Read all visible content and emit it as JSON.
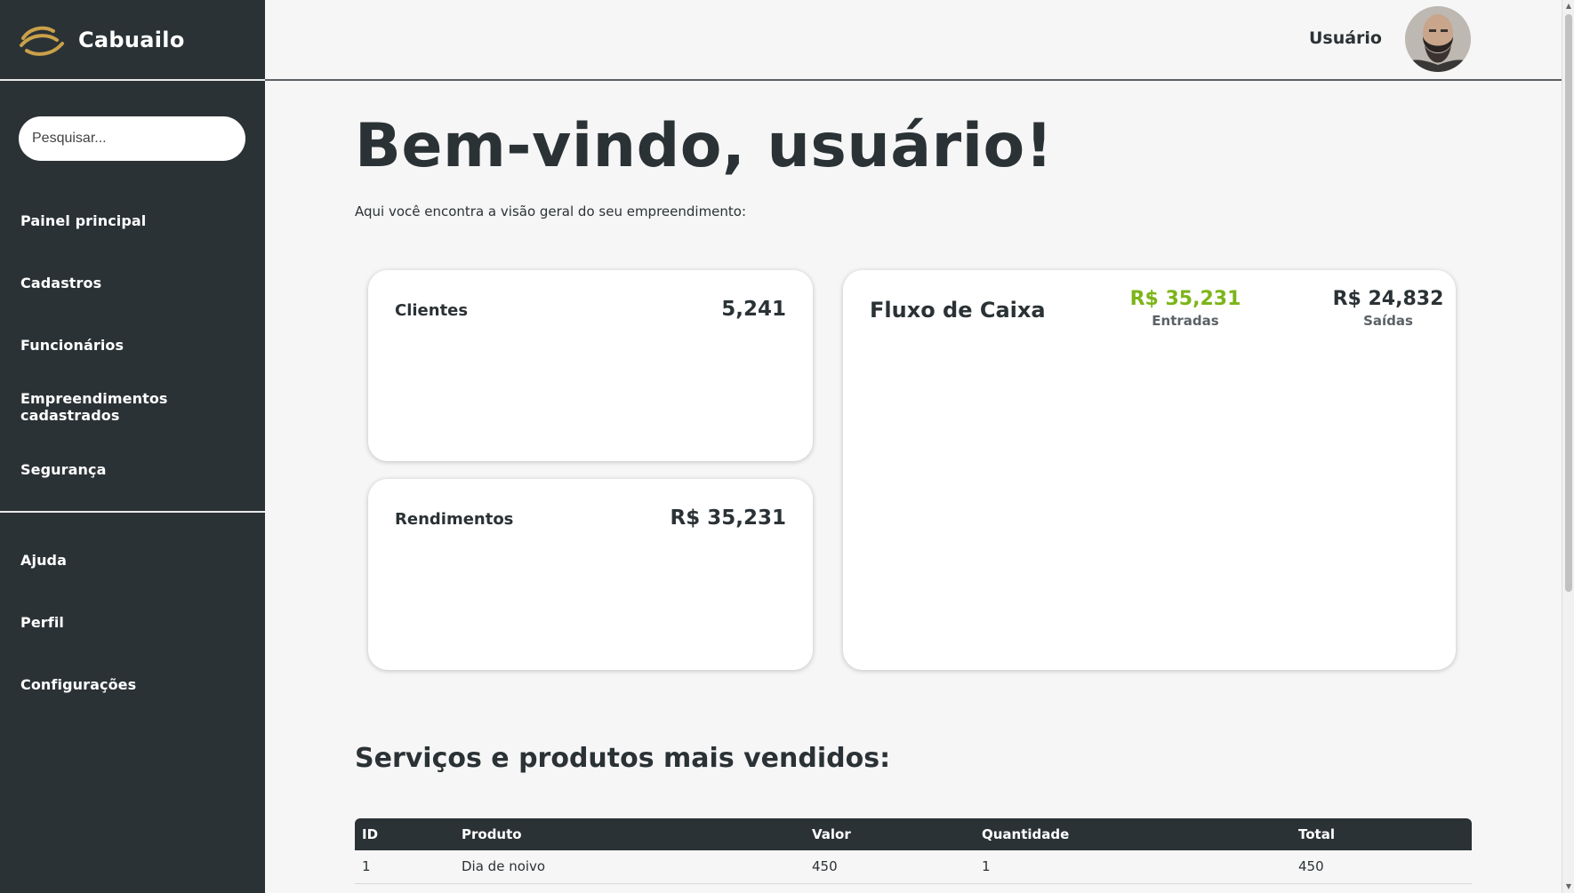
{
  "app": {
    "brand_name": "Cabuailo"
  },
  "search": {
    "placeholder": "Pesquisar..."
  },
  "sidebar": {
    "items": [
      {
        "label": "Painel principal"
      },
      {
        "label": "Cadastros"
      },
      {
        "label": "Funcionários"
      },
      {
        "label": "Empreendimentos cadastrados"
      },
      {
        "label": "Segurança"
      }
    ],
    "bottom_items": [
      {
        "label": "Ajuda"
      },
      {
        "label": "Perfil"
      },
      {
        "label": "Configurações"
      }
    ]
  },
  "header": {
    "user_name": "Usuário"
  },
  "main": {
    "title": "Bem-vindo, usuário!",
    "subtitle": "Aqui você encontra a visão geral do seu empreendimento:",
    "cards": {
      "clientes": {
        "title": "Clientes",
        "value": "5,241"
      },
      "rendimentos": {
        "title": "Rendimentos",
        "value": "R$ 35,231"
      },
      "fluxo": {
        "title": "Fluxo de Caixa",
        "entradas_value": "R$ 35,231",
        "entradas_label": "Entradas",
        "saidas_value": "R$ 24,832",
        "saidas_label": "Saídas"
      }
    },
    "section_title": "Serviços e produtos mais vendidos:",
    "table": {
      "headers": [
        "ID",
        "Produto",
        "Valor",
        "Quantidade",
        "Total"
      ],
      "rows": [
        [
          "1",
          "Dia de noivo",
          "450",
          "1",
          "450"
        ]
      ]
    }
  },
  "colors": {
    "sidebar_bg": "#2b3235",
    "accent_green": "#7cb518",
    "logo_gold": "#c9a14a"
  },
  "icons": {
    "brand": "horseshoe-logo-icon",
    "avatar": "user-avatar"
  }
}
